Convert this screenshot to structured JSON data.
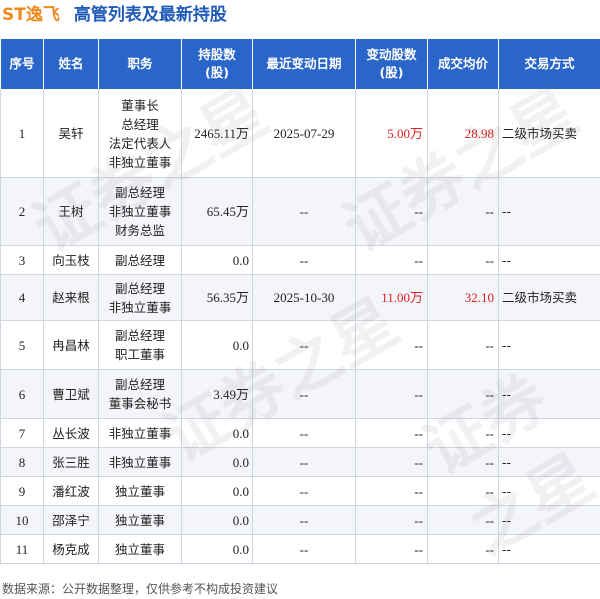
{
  "title": {
    "company": "ST逸飞",
    "subtitle": "高管列表及最新持股"
  },
  "columns": [
    "序号",
    "姓名",
    "职务",
    "持股数\n(股)",
    "最近变动日期",
    "变动股数\n(股)",
    "成交均价",
    "交易方式"
  ],
  "rows": [
    {
      "idx": "1",
      "name": "吴轩",
      "positions": [
        "董事长",
        "总经理",
        "法定代表人",
        "非独立董事"
      ],
      "shares": "2465.11万",
      "date": "2025-07-29",
      "change": "5.00万",
      "price": "28.98",
      "method": "二级市场买卖"
    },
    {
      "idx": "2",
      "name": "王树",
      "positions": [
        "副总经理",
        "非独立董事",
        "财务总监"
      ],
      "shares": "65.45万",
      "date": "--",
      "change": "--",
      "price": "--",
      "method": "--"
    },
    {
      "idx": "3",
      "name": "向玉枝",
      "positions": [
        "副总经理"
      ],
      "shares": "0.0",
      "date": "--",
      "change": "--",
      "price": "--",
      "method": "--"
    },
    {
      "idx": "4",
      "name": "赵来根",
      "positions": [
        "副总经理",
        "非独立董事"
      ],
      "shares": "56.35万",
      "date": "2025-10-30",
      "change": "11.00万",
      "price": "32.10",
      "method": "二级市场买卖"
    },
    {
      "idx": "5",
      "name": "冉昌林",
      "positions": [
        "副总经理",
        "职工董事"
      ],
      "shares": "0.0",
      "date": "--",
      "change": "--",
      "price": "--",
      "method": "--"
    },
    {
      "idx": "6",
      "name": "曹卫斌",
      "positions": [
        "副总经理",
        "董事会秘书"
      ],
      "shares": "3.49万",
      "date": "--",
      "change": "--",
      "price": "--",
      "method": "--"
    },
    {
      "idx": "7",
      "name": "丛长波",
      "positions": [
        "非独立董事"
      ],
      "shares": "0.0",
      "date": "--",
      "change": "--",
      "price": "--",
      "method": "--"
    },
    {
      "idx": "8",
      "name": "张三胜",
      "positions": [
        "非独立董事"
      ],
      "shares": "0.0",
      "date": "--",
      "change": "--",
      "price": "--",
      "method": "--"
    },
    {
      "idx": "9",
      "name": "潘红波",
      "positions": [
        "独立董事"
      ],
      "shares": "0.0",
      "date": "--",
      "change": "--",
      "price": "--",
      "method": "--"
    },
    {
      "idx": "10",
      "name": "邵泽宁",
      "positions": [
        "独立董事"
      ],
      "shares": "0.0",
      "date": "--",
      "change": "--",
      "price": "--",
      "method": "--"
    },
    {
      "idx": "11",
      "name": "杨克成",
      "positions": [
        "独立董事"
      ],
      "shares": "0.0",
      "date": "--",
      "change": "--",
      "price": "--",
      "method": "--"
    }
  ],
  "footer": "数据来源：公开数据整理，仅供参考不构成投资建议",
  "watermark": "证券之星",
  "colors": {
    "header_bg": "#2a66c9",
    "company": "#f08a1f",
    "subtitle": "#1f5bb8",
    "positive": "#e02020"
  }
}
